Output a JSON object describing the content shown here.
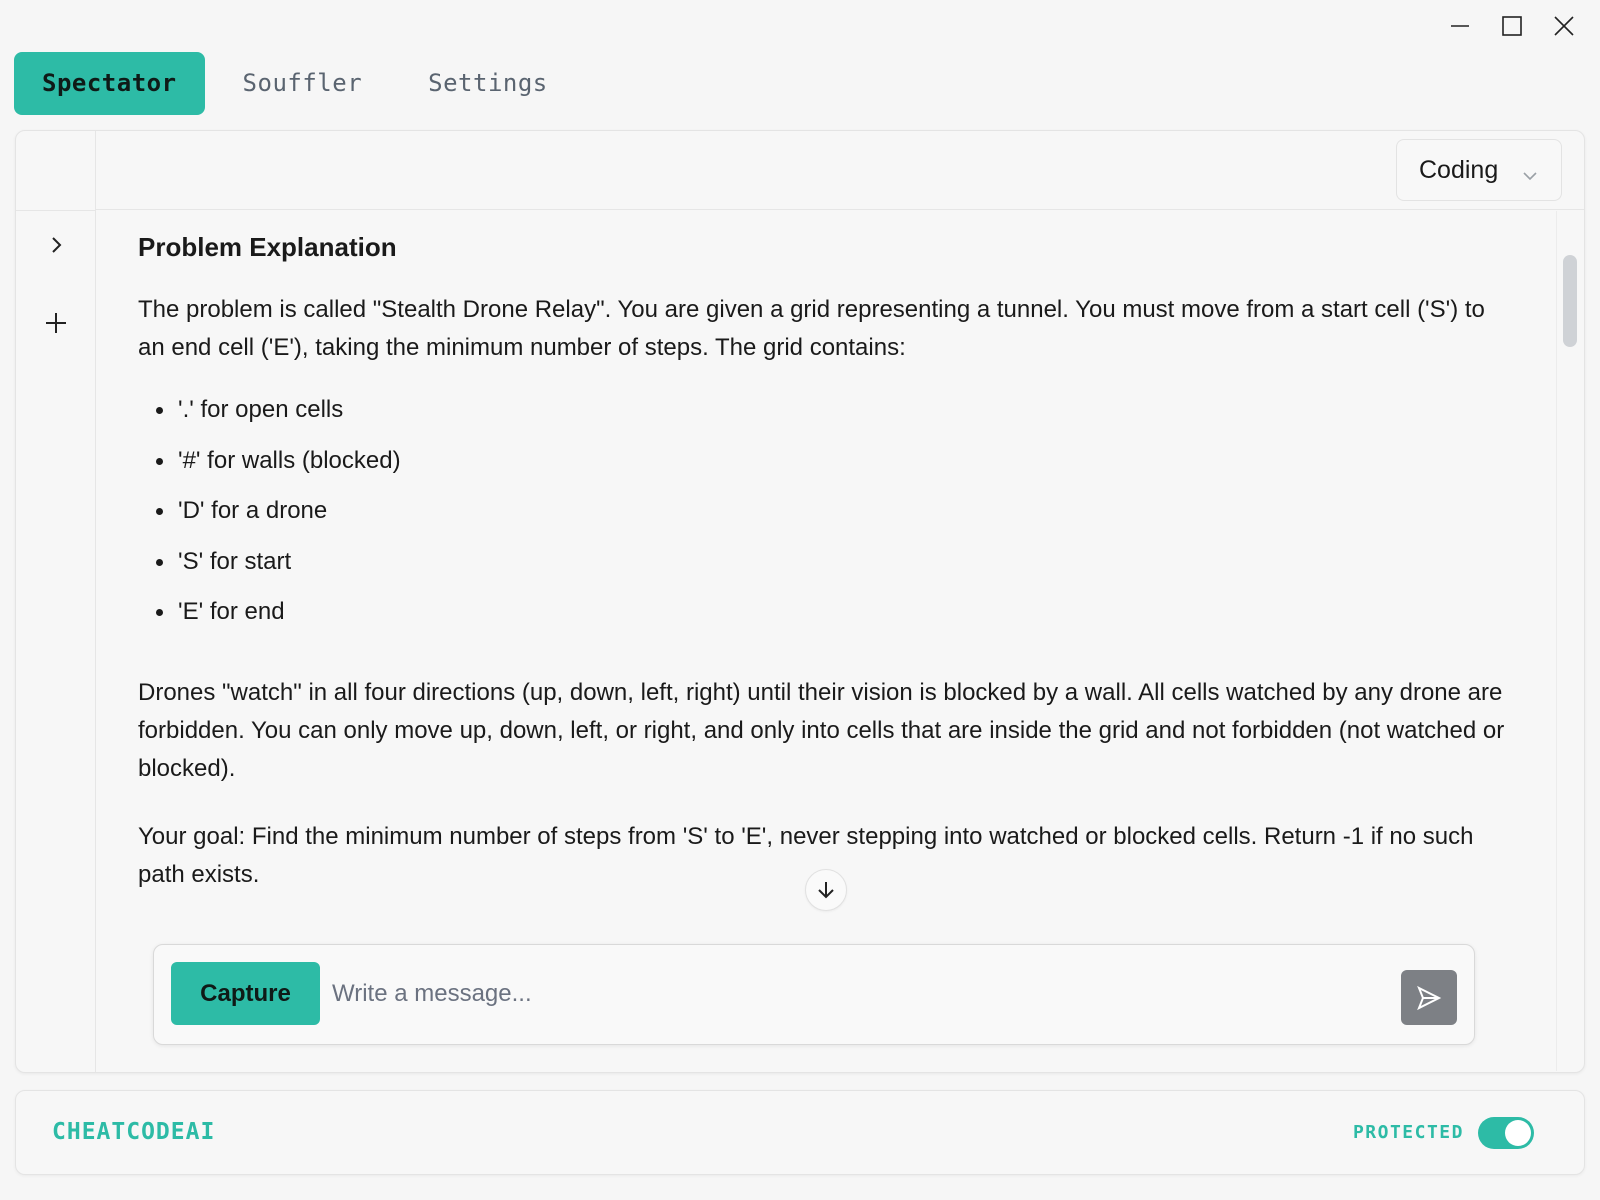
{
  "tabs": [
    {
      "label": "Spectator",
      "active": true
    },
    {
      "label": "Souffler",
      "active": false
    },
    {
      "label": "Settings",
      "active": false
    }
  ],
  "mode_select": {
    "value": "Coding"
  },
  "content": {
    "heading": "Problem Explanation",
    "intro": "The problem is called \"Stealth Drone Relay\". You are given a grid representing a tunnel. You must move from a start cell ('S') to an end cell ('E'), taking the minimum number of steps. The grid contains:",
    "bullets": [
      "'.' for open cells",
      "'#' for walls (blocked)",
      "'D' for a drone",
      "'S' for start",
      "'E' for end"
    ],
    "para2": "Drones \"watch\" in all four directions (up, down, left, right) until their vision is blocked by a wall. All cells watched by any drone are forbidden. You can only move up, down, left, or right, and only into cells that are inside the grid and not forbidden (not watched or blocked).",
    "para3": "Your goal: Find the minimum number of steps from 'S' to 'E', never stepping into watched or blocked cells. Return -1 if no such path exists."
  },
  "composer": {
    "capture_label": "Capture",
    "placeholder": "Write a message..."
  },
  "footer": {
    "brand": "CHEATCODEAI",
    "protected_label": "PROTECTED",
    "protected_on": true
  },
  "colors": {
    "accent": "#2dbba6",
    "send_button": "#7d8085"
  },
  "icons": {
    "minimize": "minimize-icon",
    "maximize": "maximize-icon",
    "close": "close-icon",
    "expand": "chevron-right-icon",
    "new": "plus-icon",
    "dropdown": "chevron-down-icon",
    "scroll_down": "arrow-down-icon",
    "send": "send-icon"
  }
}
